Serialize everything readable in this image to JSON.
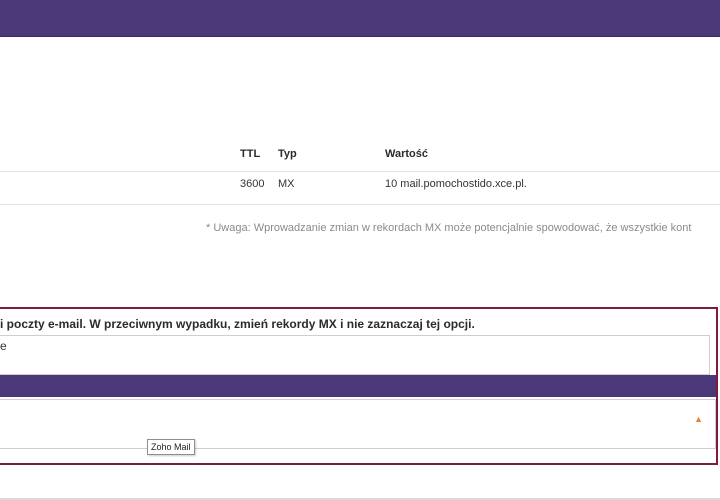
{
  "table": {
    "headers": {
      "ttl": "TTL",
      "type": "Typ",
      "value": "Wartość"
    },
    "rows": [
      {
        "ttl": "3600",
        "type": "MX",
        "value": "10 mail.pomochostido.xce.pl."
      }
    ]
  },
  "note": "* Uwaga: Wprowadzanie zmian w rekordach MX może potencjalnie spowodować, że wszystkie kont",
  "panel": {
    "warning": "i poczty e-mail. W przeciwnym wypadku, zmień rekordy MX i nie zaznaczaj tej opcji.",
    "textarea_value": "e"
  },
  "select": {
    "tooltip": "Zoho Mail",
    "arrow": "▲"
  },
  "colors": {
    "accent": "#4b3878",
    "border_highlight": "#7d1d3d",
    "arrow": "#f07f2f"
  }
}
